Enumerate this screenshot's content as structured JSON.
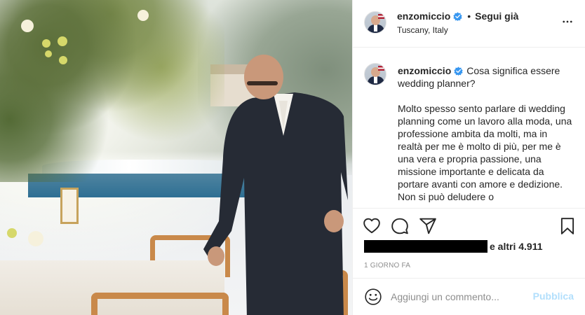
{
  "post": {
    "image_alt": "",
    "header": {
      "username": "enzomiccio",
      "separator": "•",
      "follow_label": "Segui già",
      "location": "Tuscany, Italy",
      "more_icon": "more-horizontal-icon"
    },
    "caption": {
      "username": "enzomiccio",
      "title": "Cosa significa essere wedding planner?",
      "body": "Molto spesso sento parlare di wedding planning come un lavoro alla moda, una professione ambita da molti, ma in realtà per me è molto di più, per me è una vera e propria passione, una missione importante e delicata da portare avanti con amore e dedizione. Non si può deludere o"
    },
    "actions": {
      "like_icon": "heart-icon",
      "comment_icon": "comment-icon",
      "share_icon": "paper-plane-icon",
      "save_icon": "bookmark-icon"
    },
    "likes": {
      "suffix": "e altri 4.911"
    },
    "timestamp": "1 GIORNO FA",
    "comment_box": {
      "emoji_icon": "smiley-icon",
      "placeholder": "Aggiungi un commento...",
      "publish_label": "Pubblica"
    },
    "colors": {
      "verified_blue": "#3897f0",
      "publish_disabled": "#b2dffc",
      "text_primary": "#262626",
      "text_secondary": "#8e8e8e",
      "divider": "#efefef"
    }
  }
}
